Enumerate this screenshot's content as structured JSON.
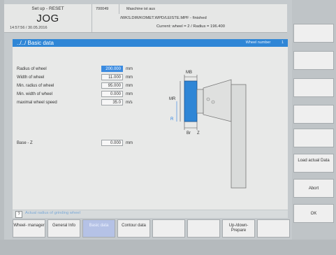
{
  "status": {
    "mode_label": "Set up - RESET",
    "mode": "JOG",
    "datetime": "14:57:56 / 30.05.2016",
    "alarm_number": "700049",
    "alarm_text": "Maschine ist aus",
    "program_path": "/WKS.DIR/KOMET.WPD/LEISTE.MPF - finished",
    "current_info": "Current:  wheel =  2   /  Radius =  196.400"
  },
  "header": {
    "title": "../../ Basic data",
    "right_label": "Wheel number",
    "wheel_number": "1"
  },
  "parameters": [
    {
      "label": "Radius of wheel",
      "value": "200.000",
      "unit": "mm"
    },
    {
      "label": "Width of wheel",
      "value": "11.000",
      "unit": "mm"
    },
    {
      "label": "Min. radius of wheel",
      "value": "95.000",
      "unit": "mm"
    },
    {
      "label": "Min. width of wheel",
      "value": "0.000",
      "unit": "mm"
    },
    {
      "label": "maximal wheel speed",
      "value": "35.0",
      "unit": "m/s"
    },
    {
      "label": "Base - Z",
      "value": "0.000",
      "unit": "mm"
    }
  ],
  "diagram": {
    "mb": "MB",
    "mr": "MR",
    "r": "R",
    "br": "Br",
    "z": "Z"
  },
  "footer": {
    "icon": "?",
    "message": "Actual radius of grinding wheel"
  },
  "right_softkeys": [
    {
      "label": ""
    },
    {
      "label": ""
    },
    {
      "label": ""
    },
    {
      "label": ""
    },
    {
      "label": ""
    },
    {
      "label": "Load actual Data"
    },
    {
      "label": "Abort"
    },
    {
      "label": "OK"
    }
  ],
  "bottom_softkeys": [
    {
      "label": "Wheel- manager"
    },
    {
      "label": "General Info"
    },
    {
      "label": "Basic data"
    },
    {
      "label": "Contour data"
    },
    {
      "label": ""
    },
    {
      "label": ""
    },
    {
      "label": "Up-/down- Prepare"
    },
    {
      "label": ""
    }
  ],
  "colors": {
    "accent": "#2f86d6",
    "wheel_fill": "#2f86d6",
    "panel": "#e8e9e8"
  }
}
